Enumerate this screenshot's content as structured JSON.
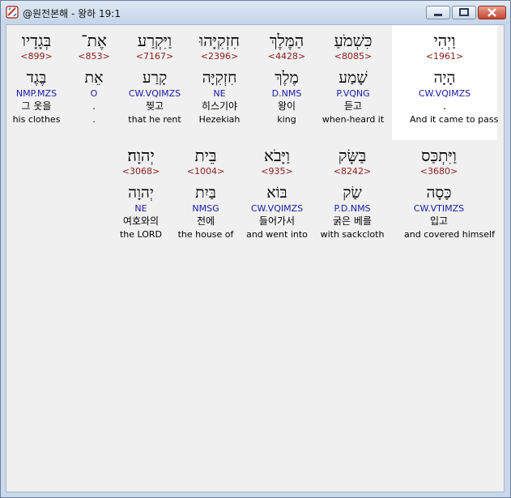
{
  "window": {
    "title": "@원전본해 - 왕하 19:1",
    "controls": {
      "minimize": "minimize",
      "maximize": "maximize",
      "close": "close"
    }
  },
  "rows": [
    {
      "words": [
        {
          "hebrew": "וַיְהִי",
          "strong": "<1961>",
          "lemma": "הָיָה",
          "morph": "CW.VQIMZS",
          "korean": ".",
          "english": "And it came to pass"
        },
        {
          "hebrew": "כִּשְׁמֹעַ",
          "strong": "<8085>",
          "lemma": "שָׁמַע",
          "morph": "P.VQNG",
          "korean": "듣고",
          "english": "when-heard it"
        },
        {
          "hebrew": "הַמֶּלֶךְ",
          "strong": "<4428>",
          "lemma": "מֶלֶךְ",
          "morph": "D.NMS",
          "korean": "왕이",
          "english": "king"
        },
        {
          "hebrew": "חִזְקִיָּהוּ",
          "strong": "<2396>",
          "lemma": "חִזְקִיָּה",
          "morph": "NE",
          "korean": "히스기야",
          "english": "Hezekiah"
        },
        {
          "hebrew": "וַיִּקְרַע",
          "strong": "<7167>",
          "lemma": "קָרַע",
          "morph": "CW.VQIMZS",
          "korean": "찢고",
          "english": "that he rent"
        },
        {
          "hebrew": "אֶת־",
          "strong": "<853>",
          "lemma": "אֵת",
          "morph": "O",
          "korean": ".",
          "english": "."
        },
        {
          "hebrew": "בְּגָדָיו",
          "strong": "<899>",
          "lemma": "בֶּגֶד",
          "morph": "NMP.MZS",
          "korean": "그 옷을",
          "english": "his clothes"
        }
      ]
    },
    {
      "words": [
        {
          "hebrew": "וַיִּתְכַּס",
          "strong": "<3680>",
          "lemma": "כָּסָה",
          "morph": "CW.VTIMZS",
          "korean": "입고",
          "english": "and covered himself"
        },
        {
          "hebrew": "בַּשָּׂק",
          "strong": "<8242>",
          "lemma": "שַׂק",
          "morph": "P.D.NMS",
          "korean": "굵은 베를",
          "english": "with sackcloth"
        },
        {
          "hebrew": "וַיָּבֹא",
          "strong": "<935>",
          "lemma": "בּוֹא",
          "morph": "CW.VQIMZS",
          "korean": "들어가서",
          "english": "and went into"
        },
        {
          "hebrew": "בֵּית",
          "strong": "<1004>",
          "lemma": "בַּיִת",
          "morph": "NMSG",
          "korean": "전에",
          "english": "the house of"
        },
        {
          "hebrew": "יְהוָה׃",
          "strong": "<3068>",
          "lemma": "יְהוָה",
          "morph": "NE",
          "korean": "여호와의",
          "english": "the LORD"
        }
      ]
    }
  ]
}
